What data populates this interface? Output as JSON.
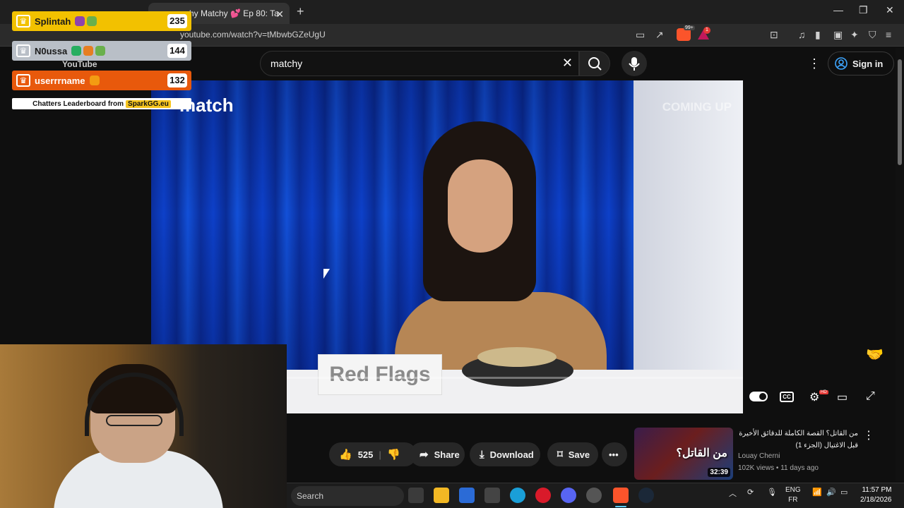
{
  "browser": {
    "tab_title": "chy Matchy 💕 Ep 80: Ta",
    "url": "youtube.com/watch?v=tMbwbGZeUgU",
    "brave_shields_count": "99+",
    "rewards_count": "1"
  },
  "youtube": {
    "logo_text": "YouTube",
    "search_value": "matchy",
    "sign_in_label": "Sign in"
  },
  "video": {
    "brand_logo": "match",
    "coming_up": "COMING UP",
    "nameplate": "Red Flags"
  },
  "player": {
    "cc_label": "CC",
    "hd_badge": "HD"
  },
  "leaderboard": {
    "rows": [
      {
        "name": "Splintah",
        "score": "235",
        "color": "#f2c100",
        "text_color": "#1a1a1a"
      },
      {
        "name": "N0ussa",
        "score": "144",
        "color": "#b9bfc7",
        "text_color": "#1a1a1a"
      },
      {
        "name": "userrrname",
        "score": "132",
        "color": "#e8590c",
        "text_color": "#ffffff"
      }
    ],
    "footer_text": "Chatters Leaderboard from",
    "footer_brand": "SparkGG.eu"
  },
  "actions": {
    "like_count": "525",
    "share_label": "Share",
    "download_label": "Download",
    "save_label": "Save"
  },
  "recommended": {
    "title": "من القاتل؟ القصة الكاملة للدقائق الأخيرة قبل الاغتيال (الجزء 1)",
    "thumb_text": "من القاتل؟",
    "channel": "Louay Cherni",
    "meta": "102K views • 11 days ago",
    "duration": "32:39"
  },
  "taskbar": {
    "search_label": "Search",
    "lang_top": "ENG",
    "lang_bottom": "FR",
    "time": "11:57 PM",
    "date": "2/18/2026"
  }
}
